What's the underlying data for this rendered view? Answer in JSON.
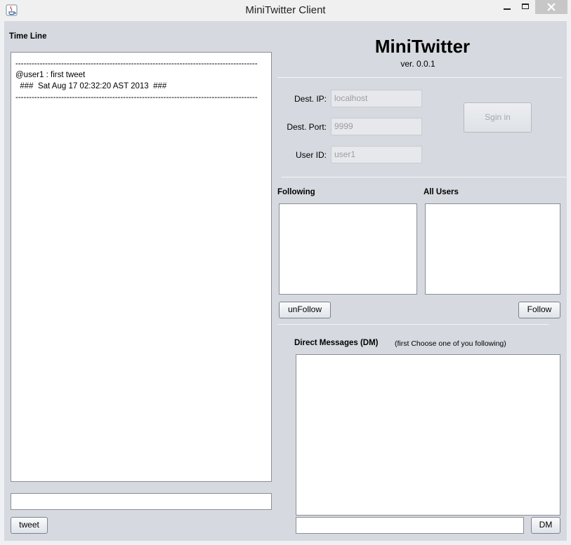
{
  "window": {
    "title": "MiniTwitter Client"
  },
  "timeline": {
    "label": "Time Line",
    "lines": [
      "------------------------------------------------------------------------------------------",
      "@user1 : first tweet",
      "  ###  Sat Aug 17 02:32:20 AST 2013  ###",
      "------------------------------------------------------------------------------------------"
    ],
    "tweet_input_value": "",
    "tweet_button": "tweet"
  },
  "header": {
    "app_name": "MiniTwitter",
    "version": "ver. 0.0.1"
  },
  "connection": {
    "dest_ip_label": "Dest. IP:",
    "dest_ip_value": "localhost",
    "dest_port_label": "Dest. Port:",
    "dest_port_value": "9999",
    "user_id_label": "User ID:",
    "user_id_value": "user1",
    "signin_button": "Sgin in"
  },
  "following": {
    "label": "Following",
    "items": [],
    "unfollow_button": "unFollow"
  },
  "all_users": {
    "label": "All Users",
    "items": [],
    "follow_button": "Follow"
  },
  "dm": {
    "label": "Direct Messages (DM)",
    "hint": "(first Choose one of you following)",
    "messages": "",
    "input_value": "",
    "send_button": "DM"
  }
}
